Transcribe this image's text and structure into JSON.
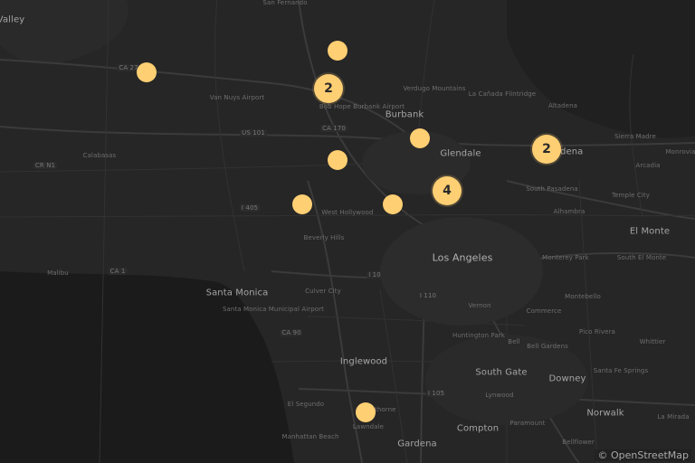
{
  "map": {
    "attribution": "© OpenStreetMap",
    "marker_color": "#ffcf73",
    "land_color": "#262626",
    "water_color": "#1b1b1b",
    "place_labels": [
      {
        "id": "valley",
        "text": "Valley",
        "size": "major"
      },
      {
        "id": "san-fernando",
        "text": "San Fernando",
        "size": "minor"
      },
      {
        "id": "ca27",
        "text": "CA 27",
        "size": "road"
      },
      {
        "id": "van-nuys-airport",
        "text": "Van Nuys Airport",
        "size": "minor"
      },
      {
        "id": "verdugo-mountains",
        "text": "Verdugo Mountains",
        "size": "minor"
      },
      {
        "id": "la-canada-flintridge",
        "text": "La Cañada Flintridge",
        "size": "minor"
      },
      {
        "id": "altadena",
        "text": "Altadena",
        "size": "minor"
      },
      {
        "id": "burbank-airport",
        "text": "Bob Hope Burbank Airport",
        "size": "minor"
      },
      {
        "id": "burbank",
        "text": "Burbank",
        "size": "major"
      },
      {
        "id": "us101",
        "text": "US 101",
        "size": "road"
      },
      {
        "id": "ca170",
        "text": "CA 170",
        "size": "road"
      },
      {
        "id": "sierra-madre",
        "text": "Sierra Madre",
        "size": "minor"
      },
      {
        "id": "monrovia",
        "text": "Monrovia",
        "size": "minor"
      },
      {
        "id": "calabasas",
        "text": "Calabasas",
        "size": "minor"
      },
      {
        "id": "cr-n1",
        "text": "CR N1",
        "size": "road"
      },
      {
        "id": "glendale",
        "text": "Glendale",
        "size": "major"
      },
      {
        "id": "pasadena",
        "text": "Pasadena",
        "size": "major"
      },
      {
        "id": "arcadia",
        "text": "Arcadia",
        "size": "minor"
      },
      {
        "id": "south-pasadena",
        "text": "South Pasadena",
        "size": "minor"
      },
      {
        "id": "temple-city",
        "text": "Temple City",
        "size": "minor"
      },
      {
        "id": "i405",
        "text": "I 405",
        "size": "road"
      },
      {
        "id": "west-hollywood",
        "text": "West Hollywood",
        "size": "minor"
      },
      {
        "id": "alhambra",
        "text": "Alhambra",
        "size": "minor"
      },
      {
        "id": "el-monte",
        "text": "El Monte",
        "size": "major"
      },
      {
        "id": "beverly-hills",
        "text": "Beverly Hills",
        "size": "minor"
      },
      {
        "id": "los-angeles",
        "text": "Los Angeles",
        "size": "big"
      },
      {
        "id": "monterey-park",
        "text": "Monterey Park",
        "size": "minor"
      },
      {
        "id": "south-el-monte",
        "text": "South El Monte",
        "size": "minor"
      },
      {
        "id": "malibu",
        "text": "Malibu",
        "size": "minor"
      },
      {
        "id": "ca1",
        "text": "CA 1",
        "size": "road"
      },
      {
        "id": "i10",
        "text": "I 10",
        "size": "road"
      },
      {
        "id": "santa-monica",
        "text": "Santa Monica",
        "size": "major"
      },
      {
        "id": "culver-city",
        "text": "Culver City",
        "size": "minor"
      },
      {
        "id": "i110",
        "text": "I 110",
        "size": "road"
      },
      {
        "id": "montebello",
        "text": "Montebello",
        "size": "minor"
      },
      {
        "id": "santa-monica-airport",
        "text": "Santa Monica Municipal Airport",
        "size": "minor"
      },
      {
        "id": "vernon",
        "text": "Vernon",
        "size": "minor"
      },
      {
        "id": "commerce",
        "text": "Commerce",
        "size": "minor"
      },
      {
        "id": "ca90",
        "text": "CA 90",
        "size": "road"
      },
      {
        "id": "huntington-park",
        "text": "Huntington Park",
        "size": "minor"
      },
      {
        "id": "bell",
        "text": "Bell",
        "size": "minor"
      },
      {
        "id": "bell-gardens",
        "text": "Bell Gardens",
        "size": "minor"
      },
      {
        "id": "pico-rivera",
        "text": "Pico Rivera",
        "size": "minor"
      },
      {
        "id": "whittier",
        "text": "Whittier",
        "size": "minor"
      },
      {
        "id": "inglewood",
        "text": "Inglewood",
        "size": "major"
      },
      {
        "id": "south-gate",
        "text": "South Gate",
        "size": "major"
      },
      {
        "id": "downey",
        "text": "Downey",
        "size": "major"
      },
      {
        "id": "santa-fe-springs",
        "text": "Santa Fe Springs",
        "size": "minor"
      },
      {
        "id": "lynwood",
        "text": "Lynwood",
        "size": "minor"
      },
      {
        "id": "i105",
        "text": "I 105",
        "size": "road"
      },
      {
        "id": "el-segundo",
        "text": "El Segundo",
        "size": "minor"
      },
      {
        "id": "hawthorne",
        "text": "Hawthorne",
        "size": "minor"
      },
      {
        "id": "lawndale",
        "text": "Lawndale",
        "size": "minor"
      },
      {
        "id": "norwalk",
        "text": "Norwalk",
        "size": "major"
      },
      {
        "id": "la-mirada",
        "text": "La Mirada",
        "size": "minor"
      },
      {
        "id": "paramount",
        "text": "Paramount",
        "size": "minor"
      },
      {
        "id": "compton",
        "text": "Compton",
        "size": "major"
      },
      {
        "id": "manhattan-beach",
        "text": "Manhattan Beach",
        "size": "minor"
      },
      {
        "id": "gardena",
        "text": "Gardena",
        "size": "major"
      },
      {
        "id": "bellflower",
        "text": "Bellflower",
        "size": "minor"
      }
    ],
    "markers": [
      {
        "id": "m1",
        "count": ""
      },
      {
        "id": "m2",
        "count": "2"
      },
      {
        "id": "m3",
        "count": ""
      },
      {
        "id": "m4",
        "count": ""
      },
      {
        "id": "m5",
        "count": "2"
      },
      {
        "id": "m6",
        "count": ""
      },
      {
        "id": "m7",
        "count": "4"
      },
      {
        "id": "m8",
        "count": ""
      },
      {
        "id": "m9",
        "count": ""
      },
      {
        "id": "m10",
        "count": ""
      }
    ]
  }
}
